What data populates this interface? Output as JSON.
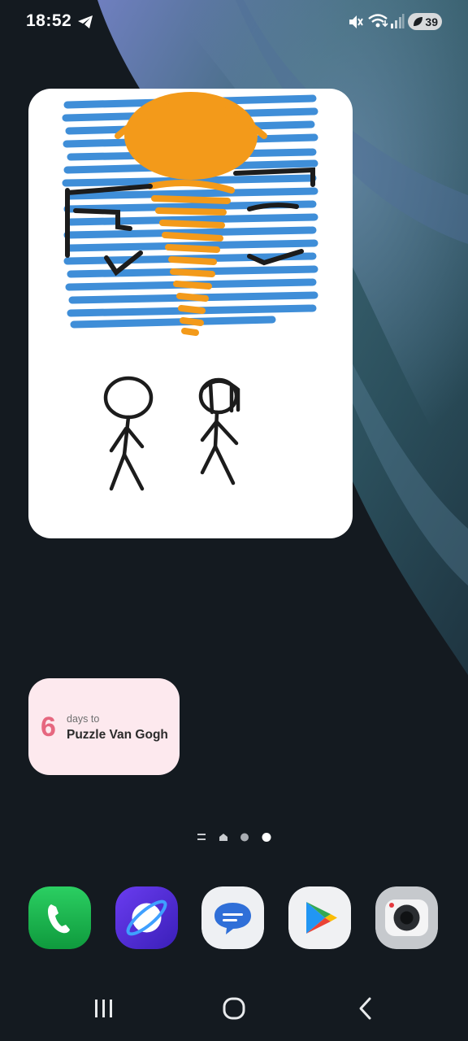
{
  "status_bar": {
    "time": "18:52",
    "battery_level": "39",
    "icons": [
      "telegram-icon",
      "vibrate-mute-icon",
      "wifi-icon",
      "cellular-signal-icon",
      "battery-saver-leaf-icon"
    ]
  },
  "widgets": {
    "drawing": {
      "icon": "sketch-drawing"
    },
    "dday": {
      "number": "6",
      "caption": "days to",
      "title": "Puzzle Van Gogh"
    }
  },
  "page_indicator": {
    "pages": [
      "list",
      "home",
      "page",
      "page"
    ],
    "active_index": 3
  },
  "dock": {
    "apps": [
      {
        "name": "Phone",
        "icon": "phone-icon",
        "color": "#17b14c"
      },
      {
        "name": "Internet",
        "icon": "internet-icon",
        "color": "#5b32d9"
      },
      {
        "name": "Messages",
        "icon": "messages-icon",
        "color": "#2f6fd8"
      },
      {
        "name": "Play Store",
        "icon": "play-store-icon",
        "color": "#f0f0f0"
      },
      {
        "name": "Camera",
        "icon": "camera-icon",
        "color": "#c5c8cc"
      }
    ]
  },
  "nav_bar": {
    "buttons": [
      "recents",
      "home",
      "back"
    ]
  },
  "colors": {
    "background": "#141a20",
    "widget_pink": "#fde9ee",
    "accent_pink": "#e6677f"
  }
}
